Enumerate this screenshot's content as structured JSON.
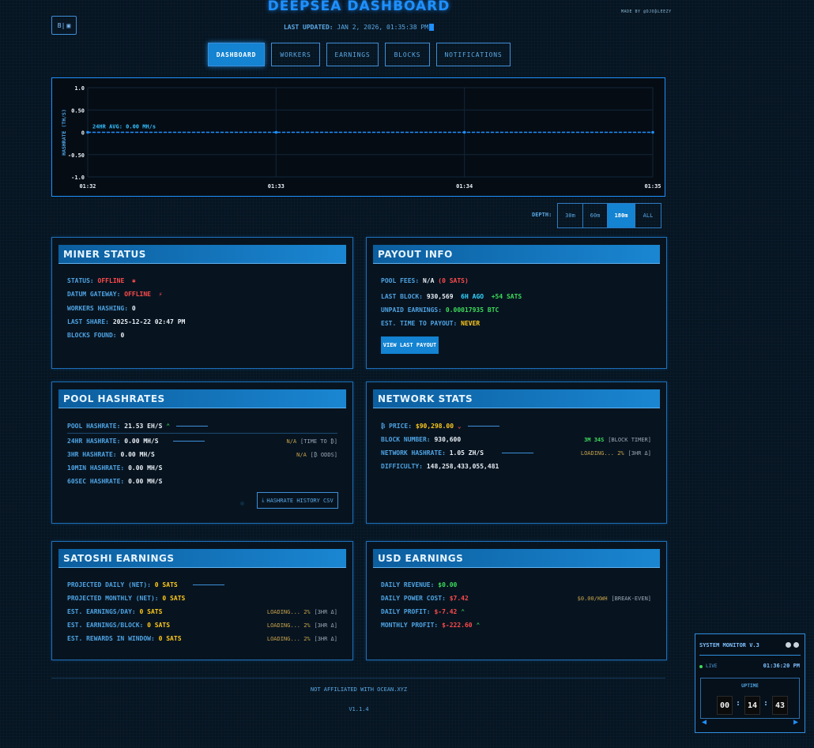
{
  "header": {
    "title": "DEEPSEA DASHBOARD",
    "made_by": "MADE BY @DJO₿LEEZY",
    "theme_toggle_label": "B|",
    "last_updated_label": "LAST UPDATED:",
    "last_updated_value": "JAN 2, 2026, 01:35:38 PM"
  },
  "tabs": [
    {
      "label": "DASHBOARD",
      "active": true
    },
    {
      "label": "WORKERS",
      "active": false
    },
    {
      "label": "EARNINGS",
      "active": false
    },
    {
      "label": "BLOCKS",
      "active": false
    },
    {
      "label": "NOTIFICATIONS",
      "active": false
    }
  ],
  "chart_data": {
    "type": "line",
    "title": "",
    "xlabel": "",
    "ylabel": "HASHRATE (TH/S)",
    "x": [
      "01:32",
      "01:33",
      "01:34",
      "01:35"
    ],
    "yticks": [
      "1.0",
      "0.50",
      "0",
      "-0.50",
      "-1.0"
    ],
    "ylim": [
      -1.0,
      1.0
    ],
    "grid": true,
    "series": [
      {
        "values": [
          0,
          0,
          0,
          0
        ],
        "color": "#1e90ff"
      }
    ],
    "annotation": "24HR AVG: 0.00 MH/s"
  },
  "depth": {
    "label": "DEPTH:",
    "options": [
      {
        "label": "30m",
        "active": false
      },
      {
        "label": "60m",
        "active": false
      },
      {
        "label": "180m",
        "active": true
      },
      {
        "label": "ALL",
        "active": false
      }
    ]
  },
  "miner_status": {
    "title": "MINER STATUS",
    "status_label": "STATUS:",
    "status_value": "OFFLINE",
    "datum_label": "DATUM GATEWAY:",
    "datum_value": "OFFLINE",
    "workers_label": "WORKERS HASHING:",
    "workers_value": "0",
    "last_share_label": "LAST SHARE:",
    "last_share_value": "2025-12-22 02:47 PM",
    "blocks_label": "BLOCKS FOUND:",
    "blocks_value": "0"
  },
  "payout_info": {
    "title": "PAYOUT INFO",
    "fees_label": "POOL FEES:",
    "fees_value": "N/A",
    "fees_sats": "(0 SATS)",
    "last_block_label": "LAST BLOCK:",
    "last_block_value": "930,569",
    "last_block_ago": "6H AGO",
    "last_block_sats": "+54 SATS",
    "unpaid_label": "UNPAID EARNINGS:",
    "unpaid_value": "0.00017935 BTC",
    "eta_label": "EST. TIME TO PAYOUT:",
    "eta_value": "NEVER",
    "button_label": "VIEW LAST PAYOUT"
  },
  "pool_hashrates": {
    "title": "POOL HASHRATES",
    "pool_label": "POOL HASHRATE:",
    "pool_value": "21.53 EH/S",
    "h24_label": "24HR HASHRATE:",
    "h24_value": "0.00 MH/S",
    "h24_note_a": "N/A",
    "h24_note_b": "[TIME TO ₿]",
    "h3_label": "3HR HASHRATE:",
    "h3_value": "0.00 MH/S",
    "h3_note_a": "N/A",
    "h3_note_b": "[₿ ODDS]",
    "m10_label": "10MIN HASHRATE:",
    "m10_value": "0.00 MH/S",
    "s60_label": "60SEC HASHRATE:",
    "s60_value": "0.00 MH/S",
    "csv_button": "HASHRATE HISTORY CSV"
  },
  "network_stats": {
    "title": "NETWORK STATS",
    "price_label": "₿ PRICE:",
    "price_value": "$90,298.00",
    "block_label": "BLOCK NUMBER:",
    "block_value": "930,600",
    "block_timer_a": "3M 34S",
    "block_timer_b": "[BLOCK TIMER]",
    "net_label": "NETWORK HASHRATE:",
    "net_value": "1.05 ZH/S",
    "net_note_a": "LOADING... 2%",
    "net_note_b": "[3HR Δ]",
    "diff_label": "DIFFICULTY:",
    "diff_value": "148,258,433,055,481"
  },
  "satoshi_earnings": {
    "title": "SATOSHI EARNINGS",
    "daily_label": "PROJECTED DAILY (NET):",
    "daily_value": "0 SATS",
    "monthly_label": "PROJECTED MONTHLY (NET):",
    "monthly_value": "0 SATS",
    "per_day_label": "EST. EARNINGS/DAY:",
    "per_day_value": "0 SATS",
    "per_day_note_a": "LOADING... 2%",
    "per_day_note_b": "[3HR Δ]",
    "per_block_label": "EST. EARNINGS/BLOCK:",
    "per_block_value": "0 SATS",
    "per_block_note_a": "LOADING... 2%",
    "per_block_note_b": "[3HR Δ]",
    "window_label": "EST. REWARDS IN WINDOW:",
    "window_value": "0 SATS",
    "window_note_a": "LOADING... 2%",
    "window_note_b": "[3HR Δ]"
  },
  "usd_earnings": {
    "title": "USD EARNINGS",
    "revenue_label": "DAILY REVENUE:",
    "revenue_value": "$0.00",
    "power_label": "DAILY POWER COST:",
    "power_value": "$7.42",
    "power_note_a": "$0.00/KWH",
    "power_note_b": "[BREAK-EVEN]",
    "profit_label": "DAILY PROFIT:",
    "profit_value": "$-7.42",
    "monthly_label": "MONTHLY PROFIT:",
    "monthly_value": "$-222.60"
  },
  "footer": {
    "note": "NOT AFFILIATED WITH OCEAN.XYZ",
    "version": "V1.1.4"
  },
  "system_monitor": {
    "title": "SYSTEM MONITOR V.3",
    "live_label": "LIVE",
    "clock": "01:36:20 PM",
    "uptime_label": "UPTIME",
    "hours": "00",
    "minutes": "14",
    "seconds": "43"
  }
}
